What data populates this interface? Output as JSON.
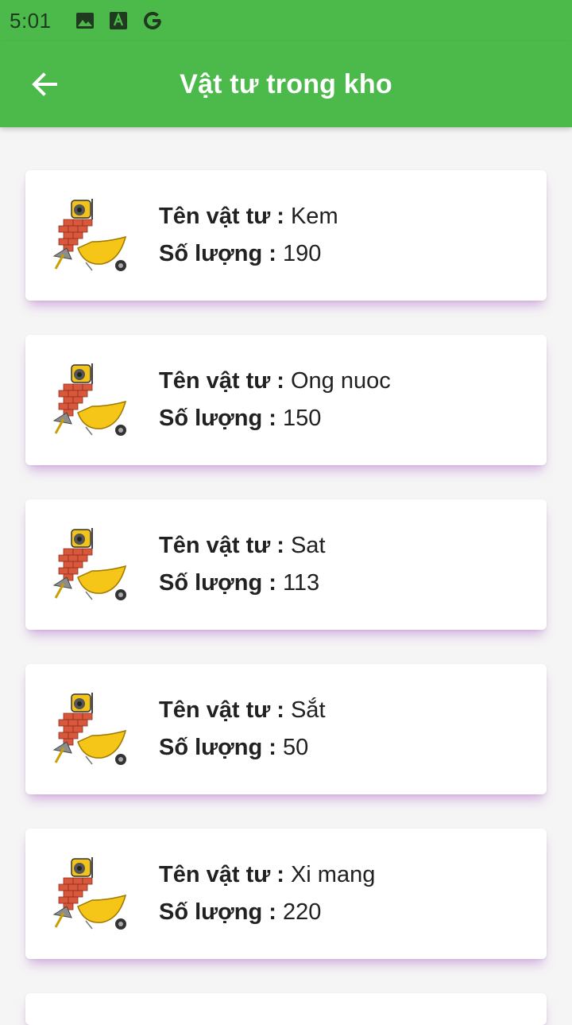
{
  "status_bar": {
    "time": "5:01",
    "icons": [
      "image-icon",
      "text-a-icon",
      "google-g-icon"
    ]
  },
  "app_bar": {
    "title": "Vật tư trong kho",
    "back_icon": "arrow-left-icon",
    "color": "#4cba4a"
  },
  "list": {
    "name_label": "Tên vật tư :",
    "qty_label": "Số lượng :",
    "item_icon": "construction-materials-icon",
    "items": [
      {
        "name": "Kem",
        "qty": "190"
      },
      {
        "name": "Ong nuoc",
        "qty": "150"
      },
      {
        "name": "Sat",
        "qty": "113"
      },
      {
        "name": "Sắt",
        "qty": "50"
      },
      {
        "name": "Xi mang",
        "qty": "220"
      }
    ]
  }
}
